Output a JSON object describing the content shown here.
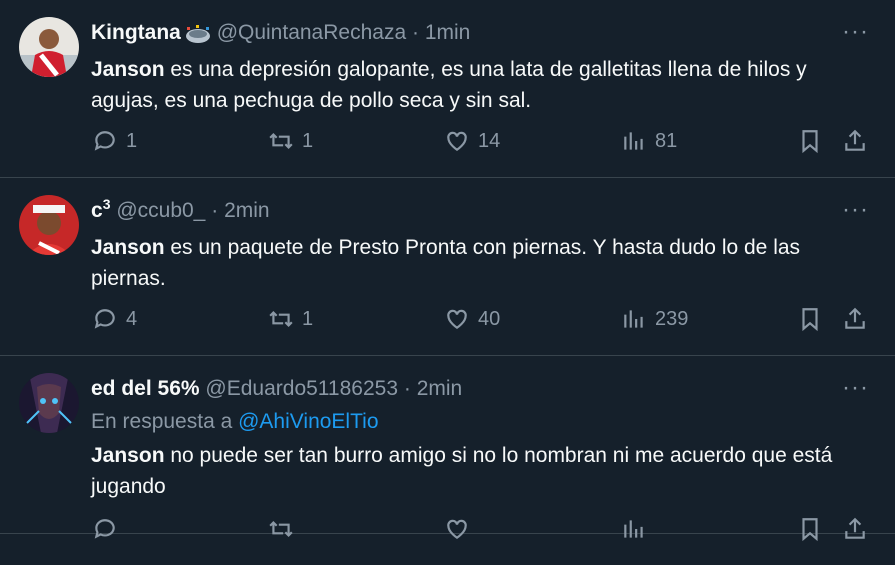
{
  "tweets": [
    {
      "name": "Kingtana",
      "handle": "@QuintanaRechaza",
      "time": "1min",
      "bold_word": "Janson",
      "text_rest": " es una depresión galopante, es una lata de galletitas llena de hilos y agujas, es una pechuga de pollo seca y sin sal.",
      "replies": "1",
      "retweets": "1",
      "likes": "14",
      "views": "81",
      "avatar_color": "#c8102e"
    },
    {
      "name": "c",
      "name_sup": "3",
      "handle": "@ccub0_",
      "time": "2min",
      "bold_word": "Janson",
      "text_rest": " es un paquete de Presto Pronta con piernas. Y hasta dudo lo de las piernas.",
      "replies": "4",
      "retweets": "1",
      "likes": "40",
      "views": "239",
      "avatar_color": "#d32f2f"
    },
    {
      "name": "ed del 56%",
      "handle": "@Eduardo51186253",
      "time": "2min",
      "reply_prefix": "En respuesta a",
      "reply_handle": "@AhiVinoElTio",
      "bold_word": "Janson",
      "text_rest": " no puede ser tan burro amigo si no lo nombran ni me acuerdo que está jugando",
      "replies": "",
      "retweets": "",
      "likes": "",
      "views": "",
      "avatar_color": "#3a2f5b"
    }
  ],
  "more_label": "···",
  "dot": "·",
  "colors": {
    "background": "#15202b",
    "text": "#f7f9f9",
    "muted": "#8b98a5",
    "link": "#1d9bf0",
    "divider": "#38444d"
  }
}
